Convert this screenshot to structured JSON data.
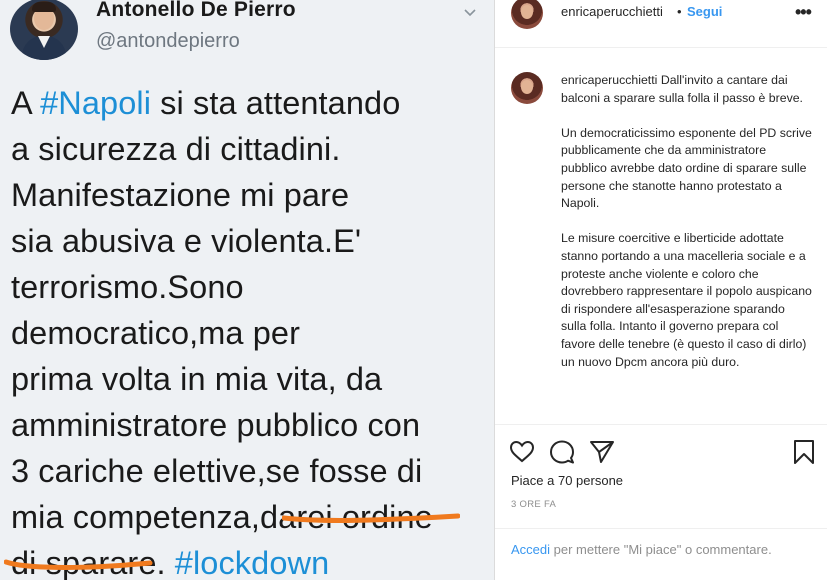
{
  "tweet": {
    "author_name": "Antonello De Pierro",
    "author_handle": "@antondepierro",
    "lines": [
      [
        "A ",
        "#Napoli",
        " si sta attentando"
      ],
      [
        "a sicurezza di cittadini."
      ],
      [
        "Manifestazione mi pare"
      ],
      [
        "sia abusiva e violenta.E'"
      ],
      [
        "terrorismo.Sono"
      ],
      [
        "democratico,ma per"
      ],
      [
        "prima volta in mia vita, da"
      ],
      [
        "amministratore pubblico con"
      ],
      [
        "3 cariche elettive,se fosse di"
      ],
      [
        "mia competenza,darei ordine"
      ],
      [
        "di sparare. ",
        "#lockdown"
      ]
    ],
    "underline_color": "#f07a1e"
  },
  "instagram": {
    "username": "enricaperucchietti",
    "dot": "•",
    "follow_label": "Segui",
    "more_label": "•••",
    "caption_username": "enricaperucchietti",
    "caption_paragraphs": [
      "Dall'invito a cantare dai balconi a sparare sulla folla il passo è breve.",
      "Un democraticissimo esponente del PD scrive pubblicamente che da amministratore pubblico avrebbe dato ordine di sparare sulle persone che stanotte hanno protestato a Napoli.",
      "Le misure coercitive e liberticide adottate stanno portando a una macelleria sociale e a proteste anche violente e coloro che dovrebbero rappresentare il popolo auspicano di rispondere all'esasperazione sparando sulla folla. Intanto il governo prepara col favore delle tenebre (è questo il caso di dirlo) un nuovo Dpcm ancora più duro."
    ],
    "actions": {
      "like_icon": "heart-icon",
      "comment_icon": "comment-icon",
      "share_icon": "share-icon",
      "save_icon": "bookmark-icon"
    },
    "likes_text": "Piace a 70 persone",
    "time_ago": "3 ORE FA",
    "login_link": "Accedi",
    "login_rest": " per mettere \"Mi piace\" o commentare."
  },
  "colors": {
    "hashtag": "#1d8fd6",
    "link": "#3897f0",
    "tweet_bg": "#eef1f4"
  }
}
